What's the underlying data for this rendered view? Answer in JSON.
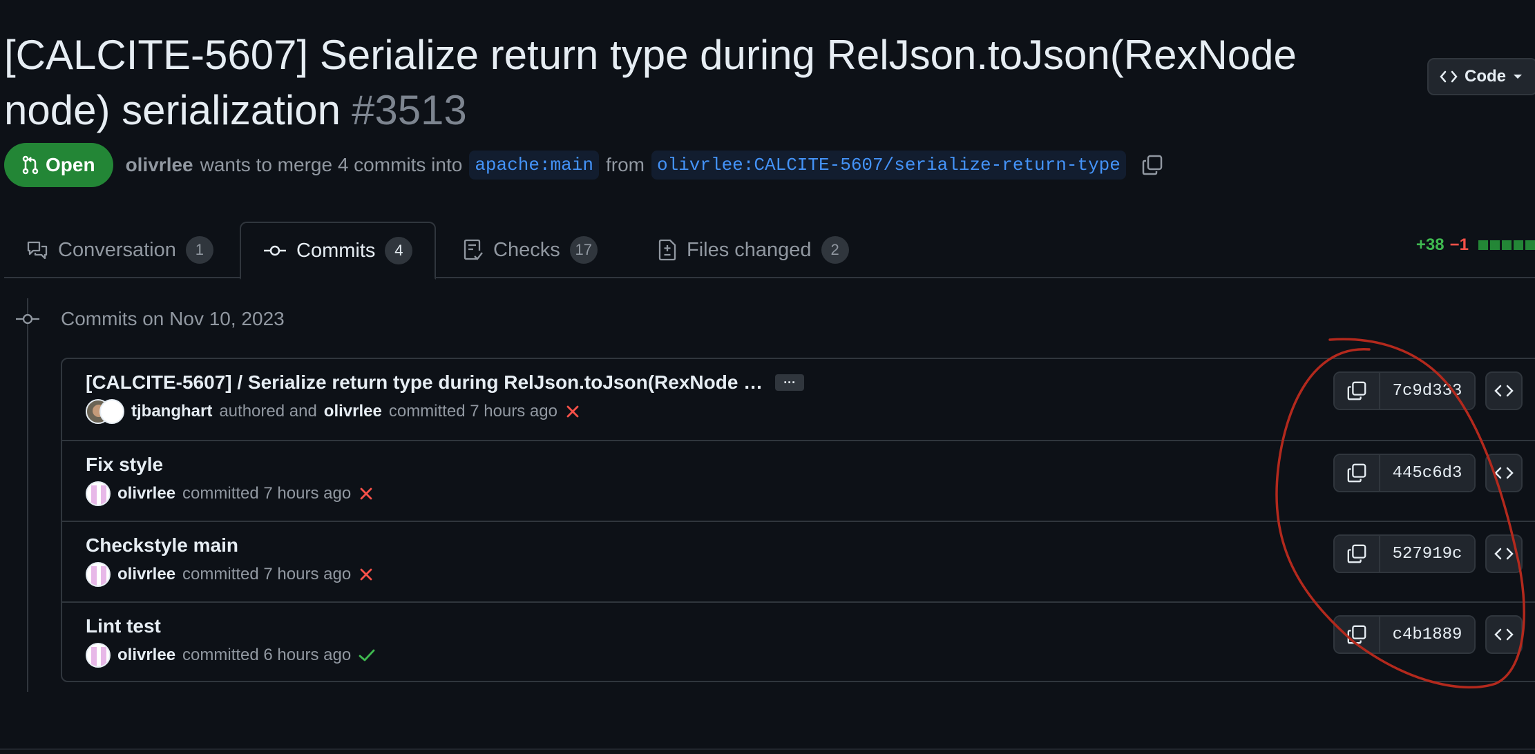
{
  "pr": {
    "title": "[CALCITE-5607] Serialize return type during RelJson.toJson(RexNode node) serialization",
    "number": "#3513",
    "state": "Open",
    "author": "olivrlee",
    "merge_text": "wants to merge 4 commits into",
    "base_branch": "apache:main",
    "from_text": "from",
    "head_branch": "olivrlee:CALCITE-5607/serialize-return-type"
  },
  "code_button": {
    "label": "Code"
  },
  "tabs": [
    {
      "label": "Conversation",
      "count": "1",
      "icon": "comment-discussion-icon"
    },
    {
      "label": "Commits",
      "count": "4",
      "icon": "git-commit-icon"
    },
    {
      "label": "Checks",
      "count": "17",
      "icon": "checklist-icon"
    },
    {
      "label": "Files changed",
      "count": "2",
      "icon": "file-diff-icon"
    }
  ],
  "diffstat": {
    "additions": "+38",
    "deletions": "−1"
  },
  "commits_group": {
    "date_label": "Commits on Nov 10, 2023",
    "commits": [
      {
        "title": "[CALCITE-5607] / Serialize return type during RelJson.toJson(RexNode …",
        "author": "tjbanghart",
        "authored_text": "authored and",
        "committer": "olivrlee",
        "committed_text": "committed 7 hours ago",
        "status": "failure",
        "sha": "7c9d333"
      },
      {
        "title": "Fix style",
        "committer": "olivrlee",
        "committed_text": "committed 7 hours ago",
        "status": "failure",
        "sha": "445c6d3"
      },
      {
        "title": "Checkstyle main",
        "committer": "olivrlee",
        "committed_text": "committed 7 hours ago",
        "status": "failure",
        "sha": "527919c"
      },
      {
        "title": "Lint test",
        "committer": "olivrlee",
        "committed_text": "committed 6 hours ago",
        "status": "success",
        "sha": "c4b1889"
      }
    ]
  },
  "colors": {
    "background": "#0d1117",
    "open_badge": "#238636",
    "link": "#4493f8",
    "failure": "#f85149",
    "success": "#3fb950",
    "annotation": "#b3291d"
  }
}
